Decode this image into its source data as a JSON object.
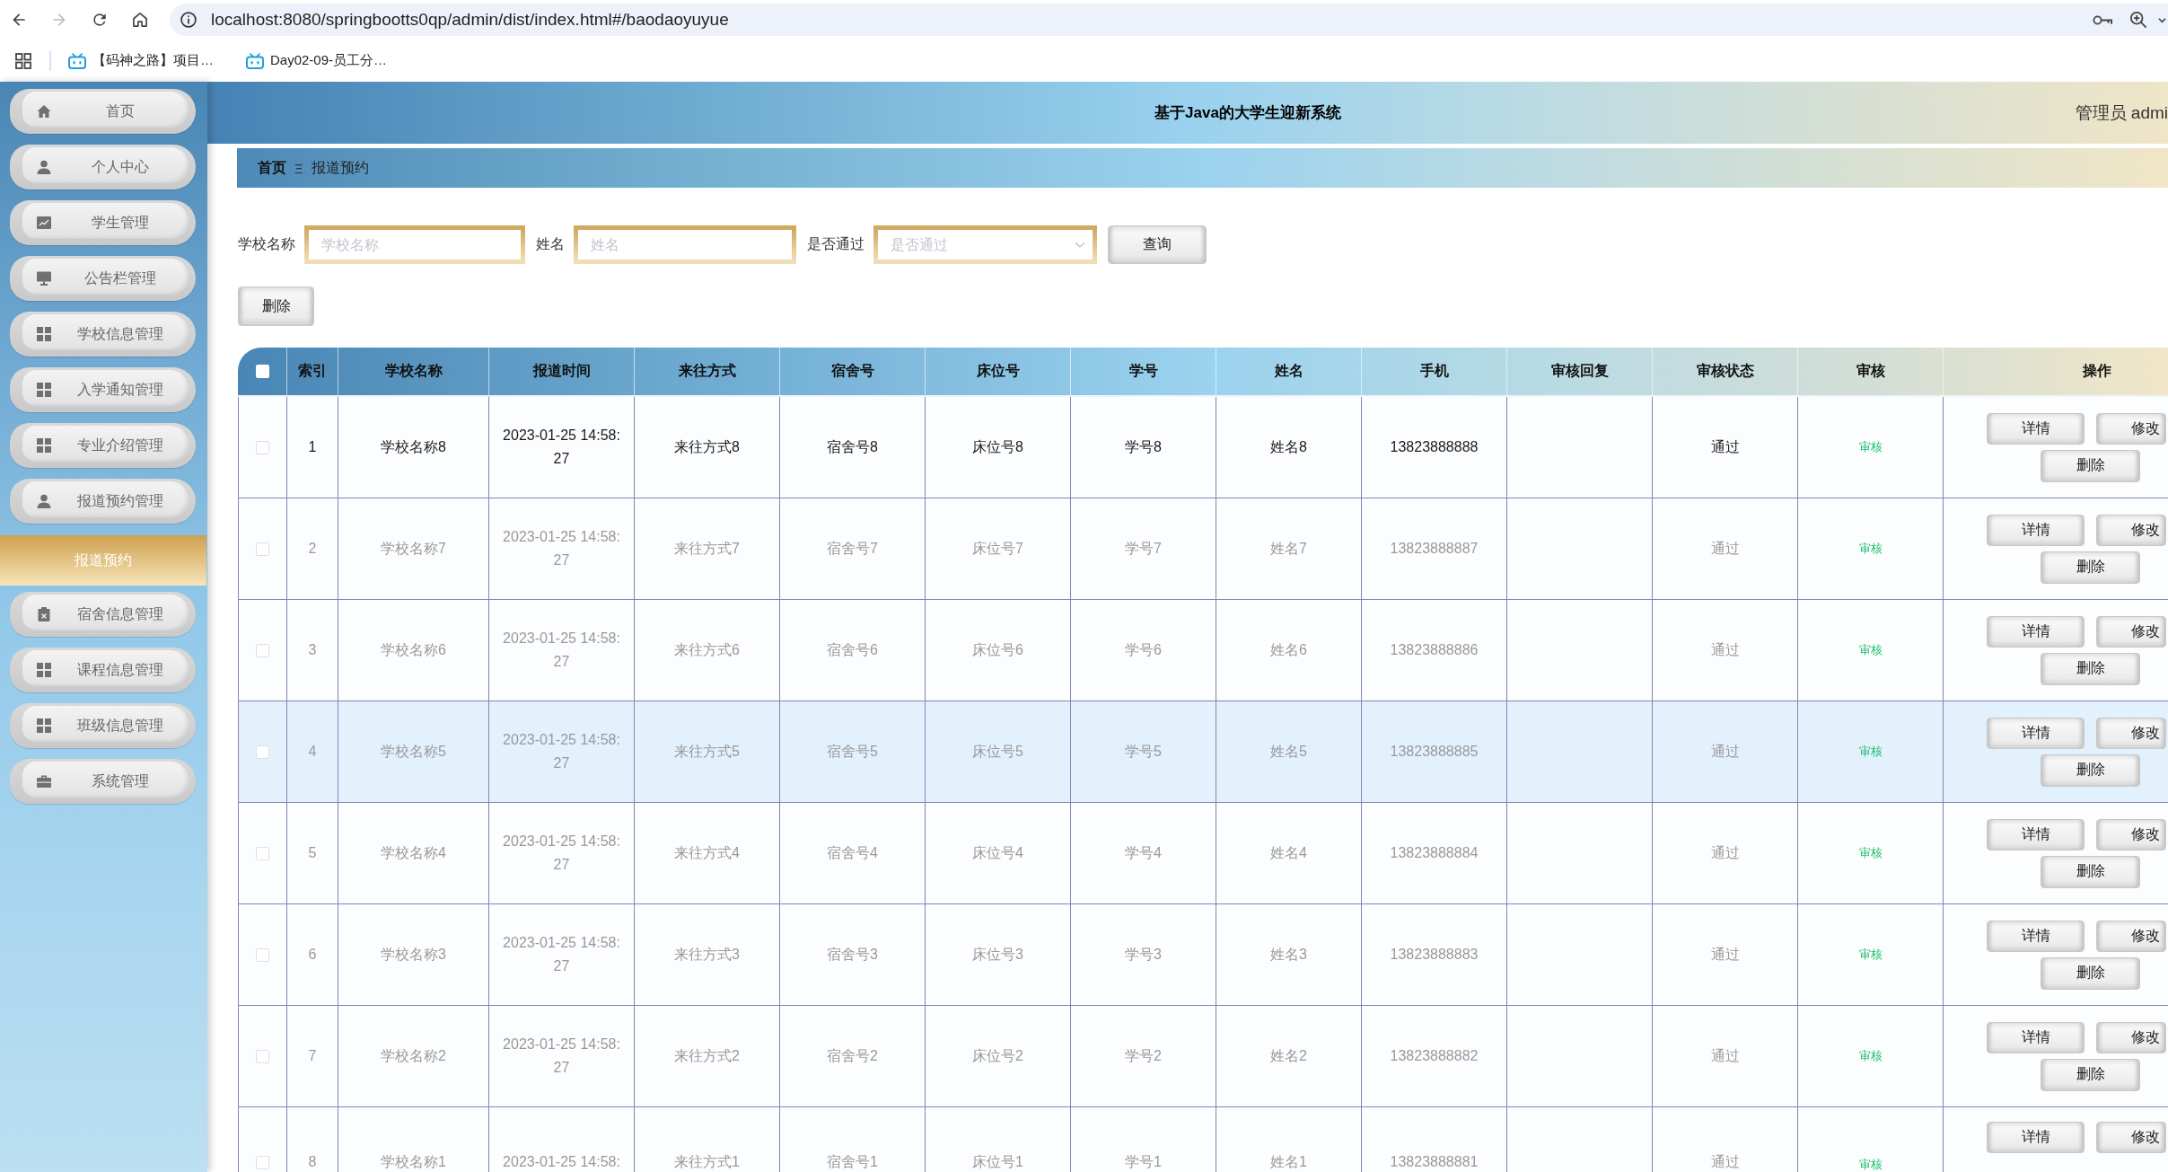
{
  "browser": {
    "url": "localhost:8080/springbootts0qp/admin/dist/index.html#/baodaoyuyue",
    "can_go_forward": false,
    "bookmarks": [
      "【码神之路】项目…",
      "Day02-09-员工分…"
    ]
  },
  "sidebar": {
    "items": [
      {
        "label": "首页",
        "selected": false
      },
      {
        "label": "个人中心",
        "selected": false
      },
      {
        "label": "学生管理",
        "selected": false
      },
      {
        "label": "公告栏管理",
        "selected": false
      },
      {
        "label": "学校信息管理",
        "selected": false
      },
      {
        "label": "入学通知管理",
        "selected": false
      },
      {
        "label": "专业介绍管理",
        "selected": false
      },
      {
        "label": "报道预约管理",
        "selected": false,
        "children": [
          {
            "label": "报道预约",
            "selected": true
          }
        ]
      },
      {
        "label": "宿舍信息管理",
        "selected": false
      },
      {
        "label": "课程信息管理",
        "selected": false
      },
      {
        "label": "班级信息管理",
        "selected": false
      },
      {
        "label": "系统管理",
        "selected": false
      }
    ]
  },
  "header": {
    "title": "基于Java的大学生迎新系统",
    "user": "管理员 admi"
  },
  "breadcrumb": {
    "items": [
      "首页",
      "报道预约"
    ],
    "separator": "Ξ"
  },
  "search": {
    "fields": [
      {
        "kind": "input",
        "label": "学校名称",
        "placeholder": "学校名称"
      },
      {
        "kind": "input",
        "label": "姓名",
        "placeholder": "姓名"
      },
      {
        "kind": "select",
        "label": "是否通过",
        "placeholder": "是否通过"
      }
    ],
    "button": "查询"
  },
  "toolbar": {
    "buttons": [
      "删除"
    ]
  },
  "table": {
    "select_all_checked": false,
    "columns": [
      "索引",
      "学校名称",
      "报道时间",
      "来往方式",
      "宿舍号",
      "床位号",
      "学号",
      "姓名",
      "手机",
      "审核回复",
      "审核状态",
      "审核",
      "操作"
    ],
    "rows": [
      {
        "checked": false,
        "current": true,
        "hovered": false,
        "index": "1",
        "school_name": "学校名称8",
        "report_time": "2023-01-25 14:58:27",
        "travel_mode": "来往方式8",
        "dorm_no": "宿舍号8",
        "bed_no": "床位号8",
        "student_no": "学号8",
        "name": "姓名8",
        "phone": "13823888888",
        "review_status": "通过",
        "review_action": "审核",
        "actions": [
          "详情",
          "修改",
          "删除"
        ]
      },
      {
        "checked": false,
        "current": false,
        "hovered": false,
        "index": "2",
        "school_name": "学校名称7",
        "report_time": "2023-01-25 14:58:27",
        "travel_mode": "来往方式7",
        "dorm_no": "宿舍号7",
        "bed_no": "床位号7",
        "student_no": "学号7",
        "name": "姓名7",
        "phone": "13823888887",
        "review_status": "通过",
        "review_action": "审核",
        "actions": [
          "详情",
          "修改",
          "删除"
        ]
      },
      {
        "checked": false,
        "current": false,
        "hovered": false,
        "index": "3",
        "school_name": "学校名称6",
        "report_time": "2023-01-25 14:58:27",
        "travel_mode": "来往方式6",
        "dorm_no": "宿舍号6",
        "bed_no": "床位号6",
        "student_no": "学号6",
        "name": "姓名6",
        "phone": "13823888886",
        "review_status": "通过",
        "review_action": "审核",
        "actions": [
          "详情",
          "修改",
          "删除"
        ]
      },
      {
        "checked": false,
        "current": false,
        "hovered": true,
        "index": "4",
        "school_name": "学校名称5",
        "report_time": "2023-01-25 14:58:27",
        "travel_mode": "来往方式5",
        "dorm_no": "宿舍号5",
        "bed_no": "床位号5",
        "student_no": "学号5",
        "name": "姓名5",
        "phone": "13823888885",
        "review_status": "通过",
        "review_action": "审核",
        "actions": [
          "详情",
          "修改",
          "删除"
        ]
      },
      {
        "checked": false,
        "current": false,
        "hovered": false,
        "index": "5",
        "school_name": "学校名称4",
        "report_time": "2023-01-25 14:58:27",
        "travel_mode": "来往方式4",
        "dorm_no": "宿舍号4",
        "bed_no": "床位号4",
        "student_no": "学号4",
        "name": "姓名4",
        "phone": "13823888884",
        "review_status": "通过",
        "review_action": "审核",
        "actions": [
          "详情",
          "修改",
          "删除"
        ]
      },
      {
        "checked": false,
        "current": false,
        "hovered": false,
        "index": "6",
        "school_name": "学校名称3",
        "report_time": "2023-01-25 14:58:27",
        "travel_mode": "来往方式3",
        "dorm_no": "宿舍号3",
        "bed_no": "床位号3",
        "student_no": "学号3",
        "name": "姓名3",
        "phone": "13823888883",
        "review_status": "通过",
        "review_action": "审核",
        "actions": [
          "详情",
          "修改",
          "删除"
        ]
      },
      {
        "checked": false,
        "current": false,
        "hovered": false,
        "index": "7",
        "school_name": "学校名称2",
        "report_time": "2023-01-25 14:58:27",
        "travel_mode": "来往方式2",
        "dorm_no": "宿舍号2",
        "bed_no": "床位号2",
        "student_no": "学号2",
        "name": "姓名2",
        "phone": "13823888882",
        "review_status": "通过",
        "review_action": "审核",
        "actions": [
          "详情",
          "修改",
          "删除"
        ]
      },
      {
        "checked": false,
        "current": false,
        "hovered": false,
        "index": "8",
        "school_name": "学校名称1",
        "report_time": "2023-01-25 14:58:",
        "travel_mode": "来往方式1",
        "dorm_no": "宿舍号1",
        "bed_no": "床位号1",
        "student_no": "学号1",
        "name": "姓名1",
        "phone": "13823888881",
        "review_status": "通过",
        "review_action": "审核",
        "actions": [
          "详情",
          "修改"
        ]
      }
    ]
  }
}
